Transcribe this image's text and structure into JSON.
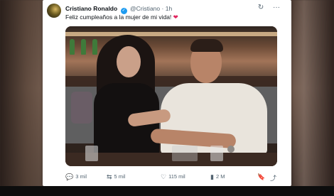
{
  "tweet": {
    "author_name": "Cristiano Ronaldo",
    "handle": "@Cristiano",
    "separator": "·",
    "time": "1h",
    "text": "Feliz cumpleaños a la mujer de mi vida!",
    "text_emoji": "❤"
  },
  "icons": {
    "grok": "↻",
    "more": "···",
    "verified": "✓"
  },
  "actions": {
    "replies": "3 mil",
    "retweets": "5 mil",
    "likes": "115 mil",
    "views": "2 M",
    "reply_icon": "💬",
    "retweet_icon": "⇆",
    "like_icon": "♡",
    "views_icon": "▮",
    "bookmark_icon": "🔖",
    "share_icon": "⤴"
  },
  "colors": {
    "verified_blue": "#1d9bf0",
    "heart_red": "#e0245e",
    "text": "#0f1419",
    "muted": "#536471"
  }
}
